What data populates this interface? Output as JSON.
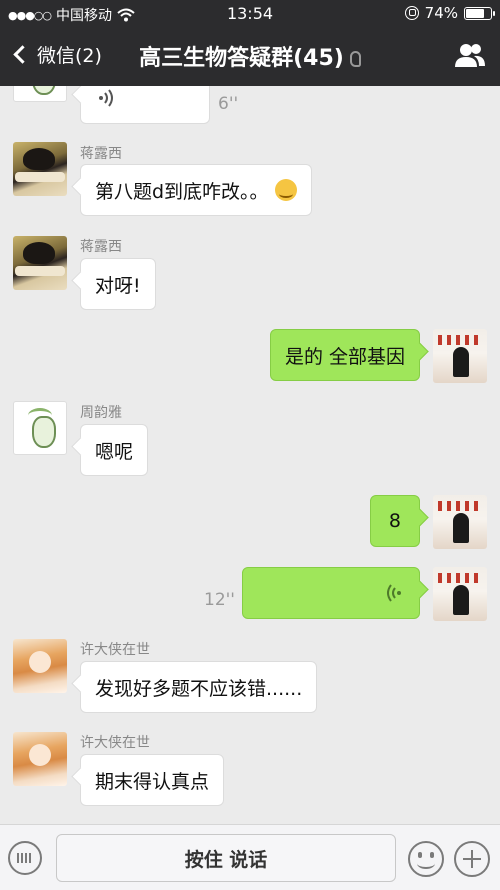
{
  "status_bar": {
    "signal": "●●●○○",
    "carrier": "中国移动",
    "time": "13:54",
    "battery": "74%",
    "battery_level": 0.74
  },
  "nav": {
    "back_label": "微信(2)",
    "title": "高三生物答疑群(45)"
  },
  "messages": [
    {
      "sender": "",
      "type": "voice",
      "duration": "6''"
    },
    {
      "sender": "蒋露西",
      "type": "text",
      "text": "第八题d到底咋改。。",
      "emoji": "sweat-laugh-icon"
    },
    {
      "sender": "蒋露西",
      "type": "text",
      "text": "对呀!"
    },
    {
      "sender": "self",
      "type": "text",
      "text": "是的 全部基因"
    },
    {
      "sender": "周韵雅",
      "type": "text",
      "text": "嗯呢"
    },
    {
      "sender": "self",
      "type": "text",
      "text": "8"
    },
    {
      "sender": "self",
      "type": "voice",
      "duration": "12''"
    },
    {
      "sender": "许大侠在世",
      "type": "text",
      "text": "发现好多题不应该错......"
    },
    {
      "sender": "许大侠在世",
      "type": "text",
      "text": "期末得认真点"
    }
  ],
  "input_bar": {
    "hold_to_talk": "按住 说话"
  },
  "colors": {
    "header_bg": "#2c2c2e",
    "chat_bg": "#ebebeb",
    "self_bubble": "#9fe65a"
  }
}
